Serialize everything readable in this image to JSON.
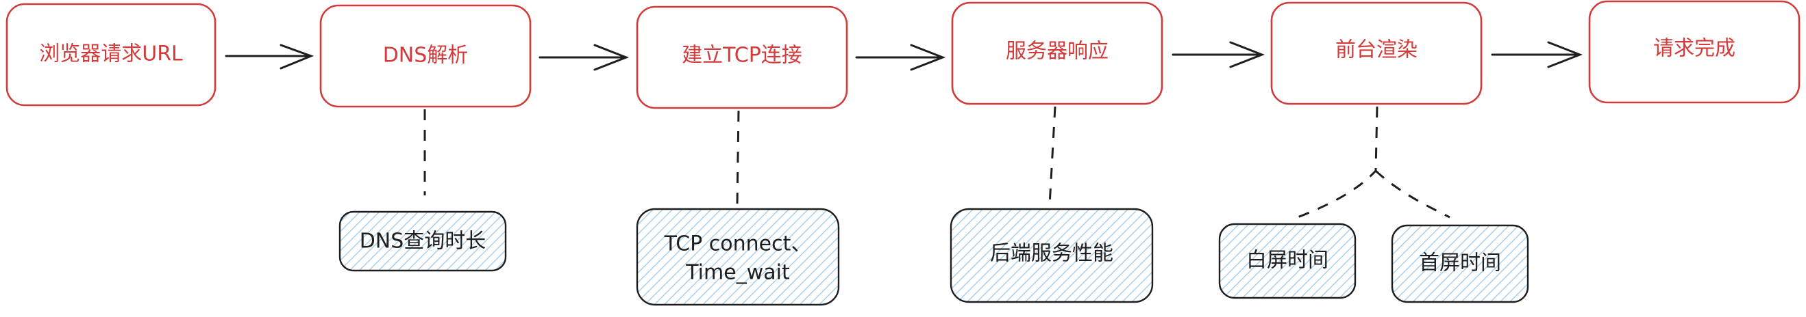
{
  "steps": [
    {
      "label": "浏览器请求URL"
    },
    {
      "label": "DNS解析"
    },
    {
      "label": "建立TCP连接"
    },
    {
      "label": "服务器响应"
    },
    {
      "label": "前台渲染"
    },
    {
      "label": "请求完成"
    }
  ],
  "metrics": [
    {
      "lines": [
        "DNS查询时长"
      ]
    },
    {
      "lines": [
        "TCP connect、",
        "Time_wait"
      ]
    },
    {
      "lines": [
        "后端服务性能"
      ]
    },
    {
      "lines": [
        "白屏时间"
      ]
    },
    {
      "lines": [
        "首屏时间"
      ]
    }
  ],
  "colors": {
    "step_stroke": "#d33a3a",
    "step_text": "#d33a3a",
    "metric_fill": "#cfe6f7",
    "metric_stroke": "#1e1e1e",
    "connector": "#1e1e1e"
  }
}
